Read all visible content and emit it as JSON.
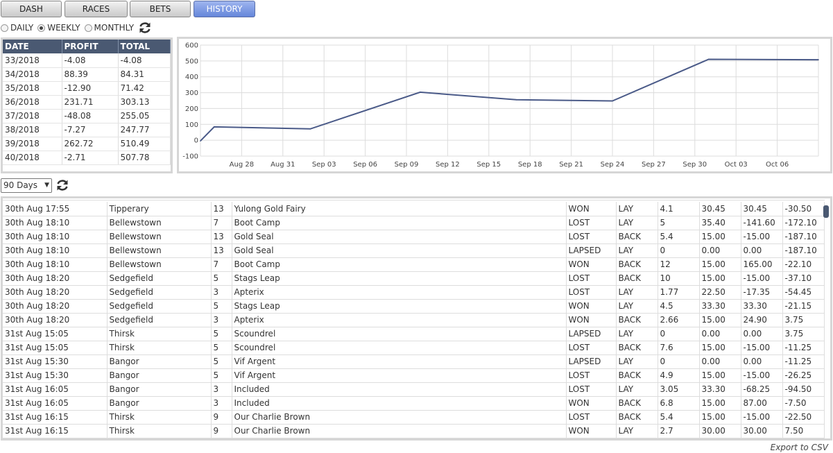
{
  "tabs": [
    {
      "label": "DASH",
      "active": false
    },
    {
      "label": "RACES",
      "active": false
    },
    {
      "label": "BETS",
      "active": false
    },
    {
      "label": "HISTORY",
      "active": true
    }
  ],
  "period_options": [
    {
      "label": "DAILY",
      "checked": false
    },
    {
      "label": "WEEKLY",
      "checked": true
    },
    {
      "label": "MONTHLY",
      "checked": false
    }
  ],
  "summary": {
    "headers": [
      "DATE",
      "PROFIT",
      "TOTAL"
    ],
    "rows": [
      [
        "33/2018",
        "-4.08",
        "-4.08"
      ],
      [
        "34/2018",
        "88.39",
        "84.31"
      ],
      [
        "35/2018",
        "-12.90",
        "71.42"
      ],
      [
        "36/2018",
        "231.71",
        "303.13"
      ],
      [
        "37/2018",
        "-48.08",
        "255.05"
      ],
      [
        "38/2018",
        "-7.27",
        "247.77"
      ],
      [
        "39/2018",
        "262.72",
        "510.49"
      ],
      [
        "40/2018",
        "-2.71",
        "507.78"
      ]
    ]
  },
  "chart_data": {
    "type": "line",
    "title": "",
    "xlabel": "",
    "ylabel": "",
    "ylim": [
      -100,
      600
    ],
    "yticks": [
      -100,
      0,
      100,
      200,
      300,
      400,
      500,
      600
    ],
    "xlim": [
      "2018-08-25",
      "2018-10-09"
    ],
    "xtick_labels": [
      "Aug 28",
      "Aug 31",
      "Sep 03",
      "Sep 06",
      "Sep 09",
      "Sep 12",
      "Sep 15",
      "Sep 18",
      "Sep 21",
      "Sep 24",
      "Sep 27",
      "Sep 30",
      "Oct 03",
      "Oct 06"
    ],
    "xtick_dates": [
      "2018-08-28",
      "2018-08-31",
      "2018-09-03",
      "2018-09-06",
      "2018-09-09",
      "2018-09-12",
      "2018-09-15",
      "2018-09-18",
      "2018-09-21",
      "2018-09-24",
      "2018-09-27",
      "2018-09-30",
      "2018-10-03",
      "2018-10-06"
    ],
    "grid": true,
    "line_color": "#4a5a88",
    "points": [
      {
        "x": "2018-08-25",
        "y": -4.08
      },
      {
        "x": "2018-08-26",
        "y": 84.31
      },
      {
        "x": "2018-09-02",
        "y": 71.42
      },
      {
        "x": "2018-09-10",
        "y": 303.13
      },
      {
        "x": "2018-09-17",
        "y": 255.05
      },
      {
        "x": "2018-09-24",
        "y": 247.77
      },
      {
        "x": "2018-10-01",
        "y": 510.49
      },
      {
        "x": "2018-10-09",
        "y": 507.78
      }
    ]
  },
  "days_select": {
    "value": "90 Days"
  },
  "bets": {
    "rows": [
      [
        "30th Aug 17:55",
        "Tipperary",
        "13",
        "Yulong Gold Fairy",
        "WON",
        "LAY",
        "4.1",
        "30.45",
        "30.45",
        "-30.50"
      ],
      [
        "30th Aug 18:10",
        "Bellewstown",
        "7",
        "Boot Camp",
        "LOST",
        "LAY",
        "5",
        "35.40",
        "-141.60",
        "-172.10"
      ],
      [
        "30th Aug 18:10",
        "Bellewstown",
        "13",
        "Gold Seal",
        "LOST",
        "BACK",
        "5.4",
        "15.00",
        "-15.00",
        "-187.10"
      ],
      [
        "30th Aug 18:10",
        "Bellewstown",
        "13",
        "Gold Seal",
        "LAPSED",
        "LAY",
        "0",
        "0.00",
        "0.00",
        "-187.10"
      ],
      [
        "30th Aug 18:10",
        "Bellewstown",
        "7",
        "Boot Camp",
        "WON",
        "BACK",
        "12",
        "15.00",
        "165.00",
        "-22.10"
      ],
      [
        "30th Aug 18:20",
        "Sedgefield",
        "5",
        "Stags Leap",
        "LOST",
        "BACK",
        "10",
        "15.00",
        "-15.00",
        "-37.10"
      ],
      [
        "30th Aug 18:20",
        "Sedgefield",
        "3",
        "Apterix",
        "LOST",
        "LAY",
        "1.77",
        "22.50",
        "-17.35",
        "-54.45"
      ],
      [
        "30th Aug 18:20",
        "Sedgefield",
        "5",
        "Stags Leap",
        "WON",
        "LAY",
        "4.5",
        "33.30",
        "33.30",
        "-21.15"
      ],
      [
        "30th Aug 18:20",
        "Sedgefield",
        "3",
        "Apterix",
        "WON",
        "BACK",
        "2.66",
        "15.00",
        "24.90",
        "3.75"
      ],
      [
        "31st Aug 15:05",
        "Thirsk",
        "5",
        "Scoundrel",
        "LAPSED",
        "LAY",
        "0",
        "0.00",
        "0.00",
        "3.75"
      ],
      [
        "31st Aug 15:05",
        "Thirsk",
        "5",
        "Scoundrel",
        "LOST",
        "BACK",
        "7.6",
        "15.00",
        "-15.00",
        "-11.25"
      ],
      [
        "31st Aug 15:30",
        "Bangor",
        "5",
        "Vif Argent",
        "LAPSED",
        "LAY",
        "0",
        "0.00",
        "0.00",
        "-11.25"
      ],
      [
        "31st Aug 15:30",
        "Bangor",
        "5",
        "Vif Argent",
        "LOST",
        "BACK",
        "4.9",
        "15.00",
        "-15.00",
        "-26.25"
      ],
      [
        "31st Aug 16:05",
        "Bangor",
        "3",
        "Included",
        "LOST",
        "LAY",
        "3.05",
        "33.30",
        "-68.25",
        "-94.50"
      ],
      [
        "31st Aug 16:05",
        "Bangor",
        "3",
        "Included",
        "WON",
        "BACK",
        "6.8",
        "15.00",
        "87.00",
        "-7.50"
      ],
      [
        "31st Aug 16:15",
        "Thirsk",
        "9",
        "Our Charlie Brown",
        "LOST",
        "BACK",
        "5.4",
        "15.00",
        "-15.00",
        "-22.50"
      ],
      [
        "31st Aug 16:15",
        "Thirsk",
        "9",
        "Our Charlie Brown",
        "WON",
        "LAY",
        "2.7",
        "30.00",
        "30.00",
        "7.50"
      ]
    ]
  },
  "export_label": "Export to CSV"
}
